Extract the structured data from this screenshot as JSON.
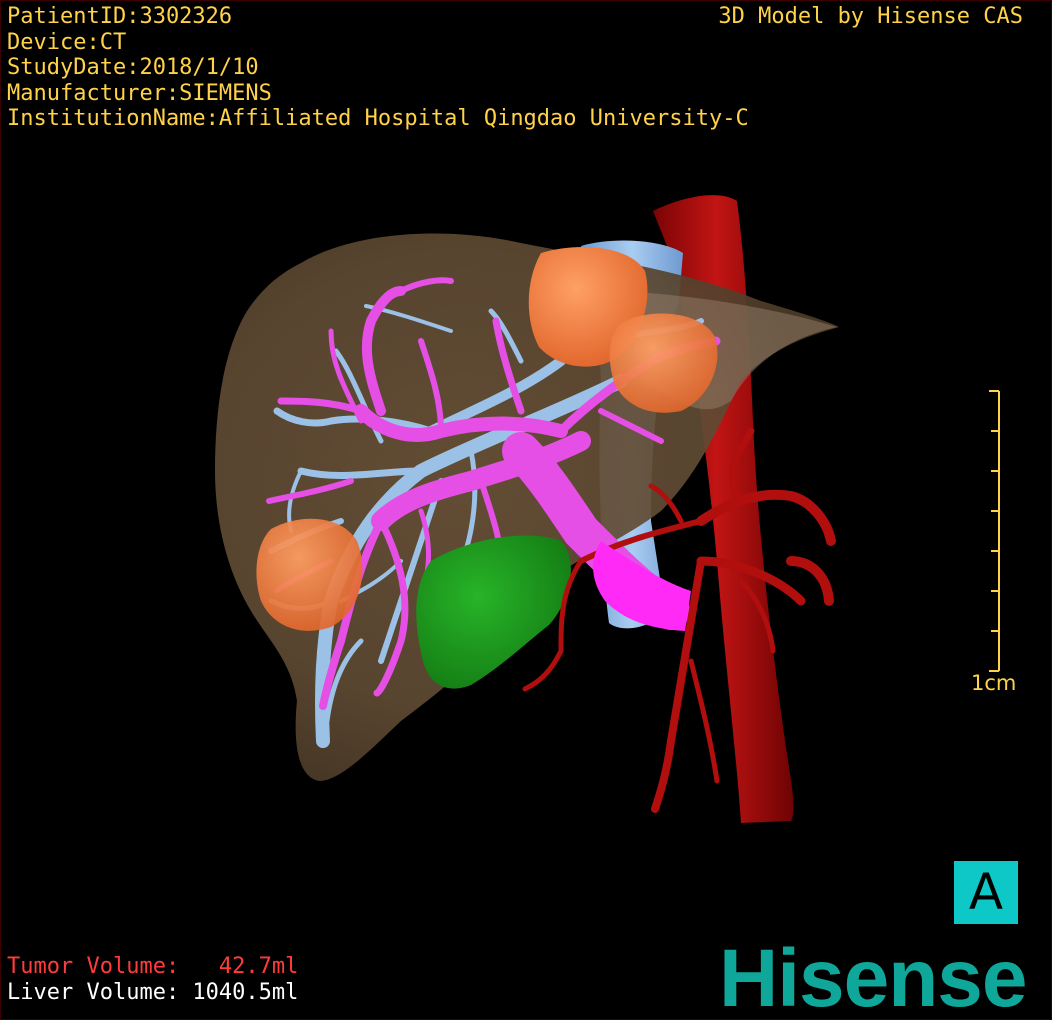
{
  "header": {
    "patient_id": "PatientID:3302326",
    "device": "Device:CT",
    "study_date": "StudyDate:2018/1/10",
    "manufacturer": "Manufacturer:SIEMENS",
    "institution": "InstitutionName:Affiliated Hospital Qingdao University-C",
    "credit": "3D Model by Hisense CAS"
  },
  "scale": {
    "label": "1cm"
  },
  "orientation": {
    "label": "A"
  },
  "volumes": {
    "tumor": "Tumor Volume:   42.7ml",
    "liver": "Liver Volume: 1040.5ml"
  },
  "logo": {
    "text": "Hisense"
  },
  "colors": {
    "text": "#ffd24a",
    "tumor_text": "#ff3b3b",
    "liver": "#7a5a36",
    "tumor": "#f07a3c",
    "portal_vein": "#e64fe6",
    "hepatic_vein": "#9cc1e6",
    "artery_aorta": "#b10e0e",
    "gallbladder": "#1c9a1c",
    "vena_cava": "#8ab7e8",
    "badge": "#0ec8c8",
    "logo": "#0fa79a"
  }
}
